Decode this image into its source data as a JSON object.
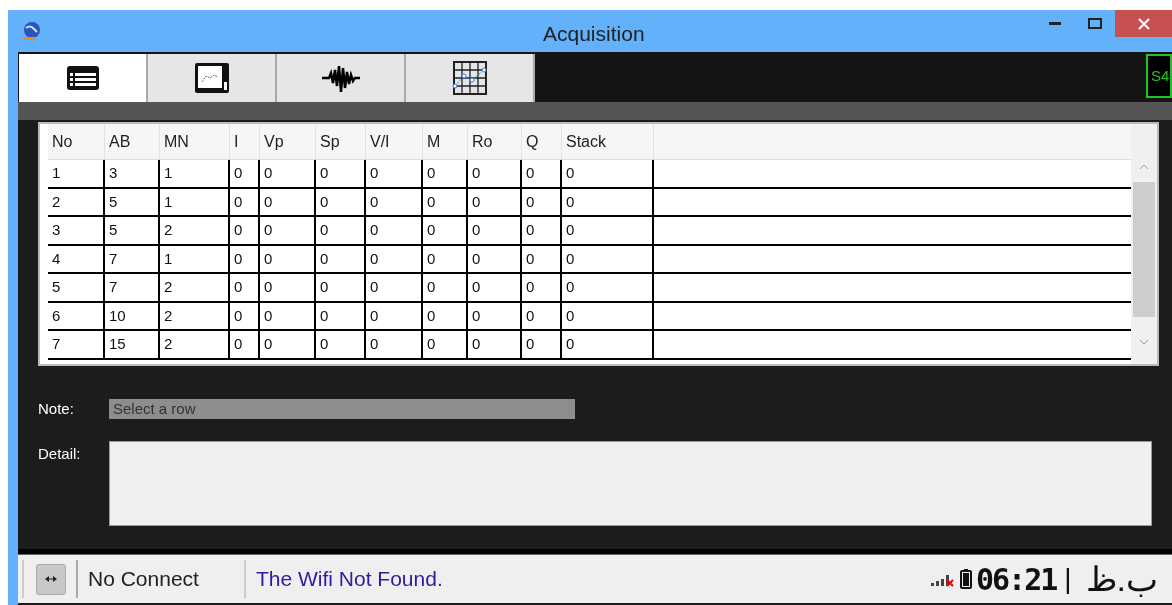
{
  "window": {
    "title": "Acquisition"
  },
  "tabs": [
    {
      "kind": "list",
      "selected": true
    },
    {
      "kind": "monitor",
      "selected": false
    },
    {
      "kind": "wave",
      "selected": false
    },
    {
      "kind": "plot",
      "selected": false
    }
  ],
  "station_badge": "S4",
  "table": {
    "columns": [
      "No",
      "AB",
      "MN",
      "I",
      "Vp",
      "Sp",
      "V/I",
      "M",
      "Ro",
      "Q",
      "Stack"
    ],
    "rows": [
      [
        "1",
        "3",
        "1",
        "0",
        "0",
        "0",
        "0",
        "0",
        "0",
        "0",
        "0"
      ],
      [
        "2",
        "5",
        "1",
        "0",
        "0",
        "0",
        "0",
        "0",
        "0",
        "0",
        "0"
      ],
      [
        "3",
        "5",
        "2",
        "0",
        "0",
        "0",
        "0",
        "0",
        "0",
        "0",
        "0"
      ],
      [
        "4",
        "7",
        "1",
        "0",
        "0",
        "0",
        "0",
        "0",
        "0",
        "0",
        "0"
      ],
      [
        "5",
        "7",
        "2",
        "0",
        "0",
        "0",
        "0",
        "0",
        "0",
        "0",
        "0"
      ],
      [
        "6",
        "10",
        "2",
        "0",
        "0",
        "0",
        "0",
        "0",
        "0",
        "0",
        "0"
      ],
      [
        "7",
        "15",
        "2",
        "0",
        "0",
        "0",
        "0",
        "0",
        "0",
        "0",
        "0"
      ]
    ]
  },
  "note": {
    "label": "Note:",
    "value": "Select a row"
  },
  "detail": {
    "label": "Detail:"
  },
  "status_bar": {
    "connection": "No Connect",
    "message": "The Wifi Not Found.",
    "clock": "06:21",
    "separator": "|",
    "period": "ب.ظ"
  }
}
